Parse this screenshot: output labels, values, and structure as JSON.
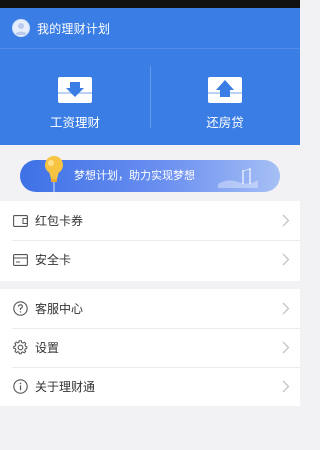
{
  "header": {
    "title": "我的理财计划",
    "avatar_icon": "avatar-icon"
  },
  "features": [
    {
      "label": "工资理财",
      "icon": "salary-icon"
    },
    {
      "label": "还房贷",
      "icon": "mortgage-icon"
    }
  ],
  "banner": {
    "text": "梦想计划，助力实现梦想",
    "icon": "lightbulb-icon"
  },
  "menu_groups": [
    {
      "items": [
        {
          "label": "红包卡券",
          "icon": "coupon-icon"
        },
        {
          "label": "安全卡",
          "icon": "card-icon"
        }
      ]
    },
    {
      "items": [
        {
          "label": "客服中心",
          "icon": "help-icon"
        },
        {
          "label": "设置",
          "icon": "gear-icon"
        },
        {
          "label": "关于理财通",
          "icon": "info-icon"
        }
      ]
    }
  ],
  "colors": {
    "brand_blue": "#3a7de5",
    "background": "#f2f2f4",
    "text": "#333333",
    "chevron": "#c4c4c4"
  }
}
